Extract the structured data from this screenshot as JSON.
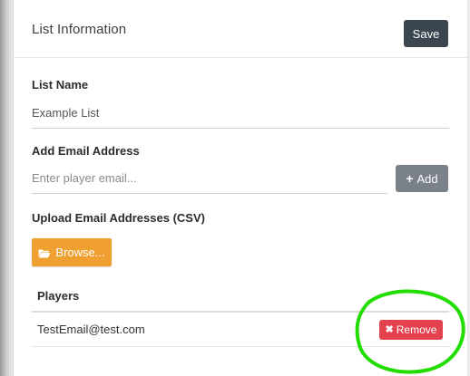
{
  "header": {
    "title": "List Information",
    "save_label": "Save"
  },
  "list_name": {
    "label": "List Name",
    "value": "Example List"
  },
  "add_email": {
    "label": "Add Email Address",
    "placeholder": "Enter player email...",
    "add_label": "Add",
    "add_icon": "plus-icon"
  },
  "upload": {
    "label": "Upload Email Addresses (CSV)",
    "browse_label": "Browse...",
    "browse_icon": "folder-open-icon"
  },
  "players": {
    "label": "Players",
    "rows": [
      {
        "email": "TestEmail@test.com",
        "remove_label": "Remove"
      }
    ],
    "remove_icon": "x-icon"
  },
  "colors": {
    "save_button": "#3b4650",
    "add_button": "#7a8188",
    "browse_button": "#f0a030",
    "remove_button": "#e3424e",
    "highlight_annotation": "#22dd00"
  }
}
